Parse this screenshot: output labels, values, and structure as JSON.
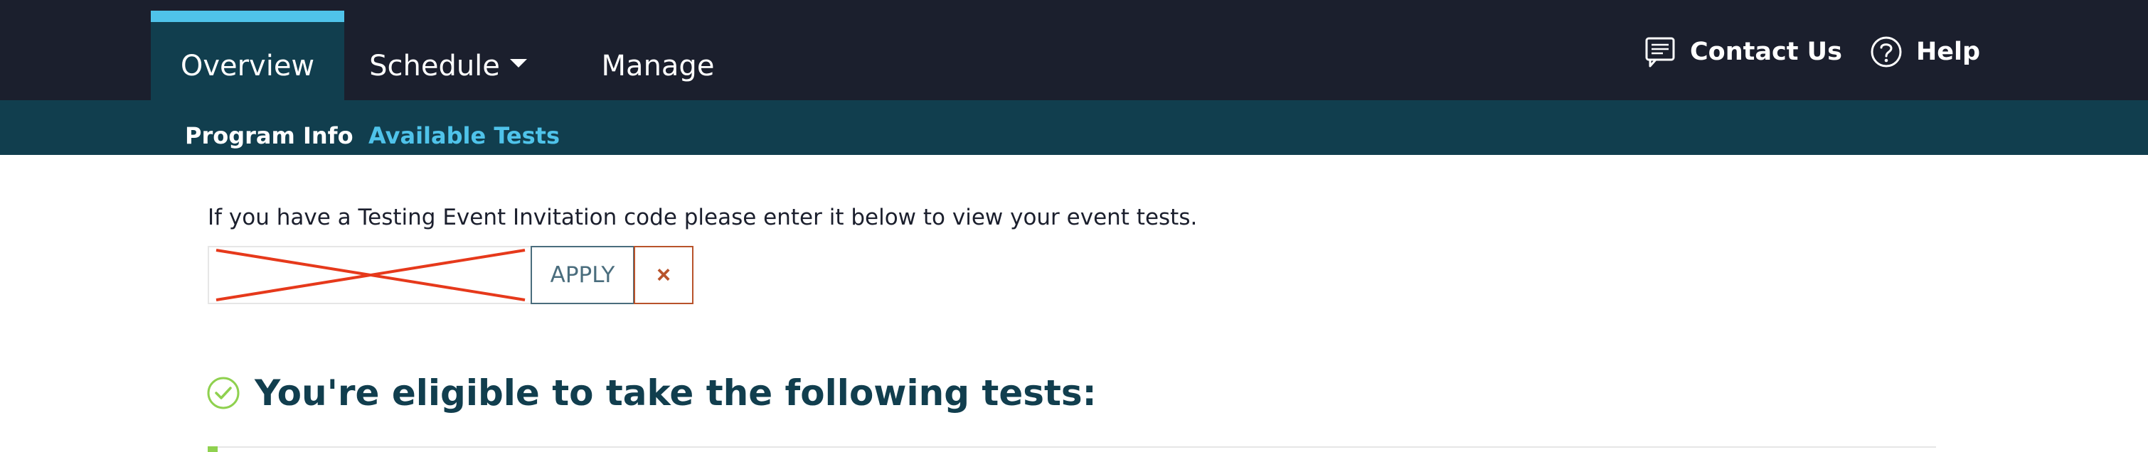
{
  "nav": {
    "tabs": [
      {
        "label": "Overview"
      },
      {
        "label": "Schedule"
      },
      {
        "label": "Manage"
      }
    ],
    "contact_label": "Contact Us",
    "help_label": "Help"
  },
  "subnav": {
    "items": [
      {
        "label": "Program Info"
      },
      {
        "label": "Available Tests"
      }
    ]
  },
  "invitation": {
    "instructions": "If you have a Testing Event Invitation code please enter it below to view your event tests.",
    "code_value": "",
    "apply_label": "APPLY",
    "clear_label": "×"
  },
  "eligible": {
    "title": "You're eligible to take the following tests:"
  },
  "colors": {
    "topbar": "#1b1f2d",
    "subbar": "#113e4e",
    "accent": "#4fc3ea",
    "success": "#8fd14f",
    "clear": "#b8532b"
  }
}
